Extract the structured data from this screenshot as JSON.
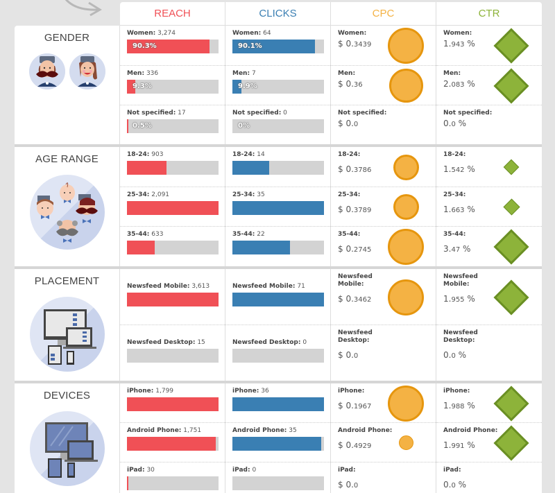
{
  "header": {
    "columns": [
      {
        "label": "REACH",
        "color": "#f05056"
      },
      {
        "label": "CLICKS",
        "color": "#3a7fb3"
      },
      {
        "label": "CPC",
        "color": "#f4b244"
      },
      {
        "label": "CTR",
        "color": "#8db33a"
      }
    ]
  },
  "sections": [
    {
      "title": "GENDER",
      "icon": "gender-avatars-icon",
      "rows": [
        {
          "label": "Women:",
          "reach": "3,274",
          "reach_fill": 0.903,
          "reach_pct": "90.3%",
          "clicks": "64",
          "clicks_fill": 0.901,
          "clicks_pct": "90.1%",
          "cpc_prefix": "$ 0.",
          "cpc_rest": "3439",
          "cpc_size": 1.0,
          "ctr_main": "1.",
          "ctr_rest": "943",
          "ctr_unit": " %",
          "ctr_size": 1.0
        },
        {
          "label": "Men:",
          "reach": "336",
          "reach_fill": 0.093,
          "reach_pct": "9.3%",
          "clicks": "7",
          "clicks_fill": 0.099,
          "clicks_pct": "9.9%",
          "cpc_prefix": "$ 0.",
          "cpc_rest": "36",
          "cpc_size": 0.95,
          "ctr_main": "2.",
          "ctr_rest": "083",
          "ctr_unit": " %",
          "ctr_size": 1.0
        },
        {
          "label": "Not specified:",
          "reach": "17",
          "reach_fill": 0.005,
          "reach_pct": "0.5%",
          "clicks": "0",
          "clicks_fill": 0,
          "clicks_pct": "0%",
          "cpc_prefix": "$ 0.",
          "cpc_rest": "0",
          "cpc_size": 0,
          "ctr_main": "0.",
          "ctr_rest": "0",
          "ctr_unit": " %",
          "ctr_size": 0
        }
      ]
    },
    {
      "title": "AGE RANGE",
      "icon": "age-range-faces-icon",
      "rows": [
        {
          "label": "18-24:",
          "reach": "903",
          "reach_fill": 0.432,
          "clicks": "14",
          "clicks_fill": 0.4,
          "cpc_prefix": "$ 0.",
          "cpc_rest": "3786",
          "cpc_size": 0.72,
          "ctr_main": "1.",
          "ctr_rest": "542",
          "ctr_unit": " %",
          "ctr_size": 0.44
        },
        {
          "label": "25-34:",
          "reach": "2,091",
          "reach_fill": 1.0,
          "clicks": "35",
          "clicks_fill": 1.0,
          "cpc_prefix": "$ 0.",
          "cpc_rest": "3789",
          "cpc_size": 0.72,
          "ctr_main": "1.",
          "ctr_rest": "663",
          "ctr_unit": " %",
          "ctr_size": 0.48
        },
        {
          "label": "35-44:",
          "reach": "633",
          "reach_fill": 0.303,
          "clicks": "22",
          "clicks_fill": 0.629,
          "cpc_prefix": "$ 0.",
          "cpc_rest": "2745",
          "cpc_size": 1.0,
          "ctr_main": "3.",
          "ctr_rest": "47",
          "ctr_unit": " %",
          "ctr_size": 1.0
        }
      ]
    },
    {
      "title": "PLACEMENT",
      "icon": "placement-devices-icon",
      "rows": [
        {
          "label": "Newsfeed Mobile:",
          "label_lines": [
            "Newsfeed",
            "Mobile:"
          ],
          "reach": "3,613",
          "reach_fill": 1.0,
          "clicks": "71",
          "clicks_fill": 1.0,
          "cpc_prefix": "$ 0.",
          "cpc_rest": "3462",
          "cpc_size": 1.0,
          "ctr_main": "1.",
          "ctr_rest": "955",
          "ctr_unit": " %",
          "ctr_size": 1.0
        },
        {
          "label": "Newsfeed Desktop:",
          "label_lines": [
            "Newsfeed",
            "Desktop:"
          ],
          "reach": "15",
          "reach_fill": 0,
          "clicks": "0",
          "clicks_fill": 0,
          "cpc_prefix": "$ 0.",
          "cpc_rest": "0",
          "cpc_size": 0,
          "ctr_main": "0.",
          "ctr_rest": "0",
          "ctr_unit": " %",
          "ctr_size": 0
        }
      ]
    },
    {
      "title": "DEVICES",
      "icon": "devices-screens-icon",
      "rows": [
        {
          "label": "iPhone:",
          "reach": "1,799",
          "reach_fill": 1.0,
          "clicks": "36",
          "clicks_fill": 1.0,
          "cpc_prefix": "$ 0.",
          "cpc_rest": "1967",
          "cpc_size": 1.0,
          "ctr_main": "1.",
          "ctr_rest": "988",
          "ctr_unit": " %",
          "ctr_size": 1.0
        },
        {
          "label": "Android Phone:",
          "reach": "1,751",
          "reach_fill": 0.973,
          "clicks": "35",
          "clicks_fill": 0.972,
          "cpc_prefix": "$ 0.",
          "cpc_rest": "4929",
          "cpc_size": 0.4,
          "ctr_main": "1.",
          "ctr_rest": "991",
          "ctr_unit": " %",
          "ctr_size": 1.0
        },
        {
          "label": "iPad:",
          "reach": "30",
          "reach_fill": 0.017,
          "clicks": "0",
          "clicks_fill": 0,
          "cpc_prefix": "$ 0.",
          "cpc_rest": "0",
          "cpc_size": 0,
          "ctr_main": "0.",
          "ctr_rest": "0",
          "ctr_unit": " %",
          "ctr_size": 0
        }
      ]
    }
  ]
}
